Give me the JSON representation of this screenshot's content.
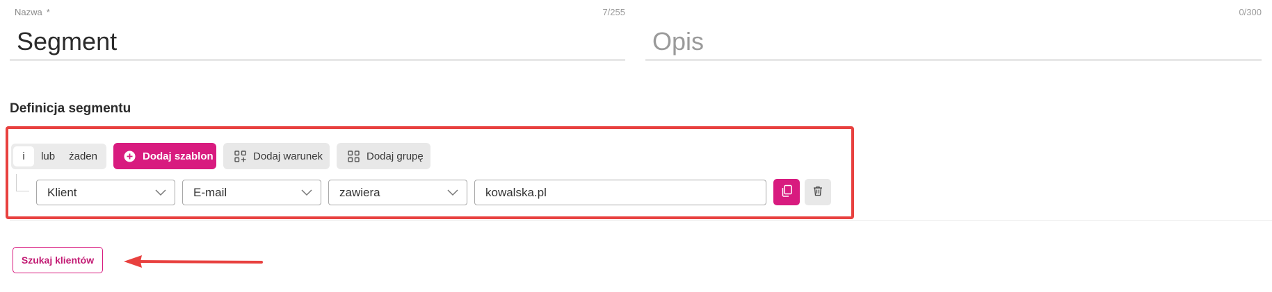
{
  "form": {
    "name": {
      "label": "Nazwa",
      "required_mark": "*",
      "counter": "7/255",
      "value": "Segment"
    },
    "description": {
      "counter": "0/300",
      "placeholder": "Opis"
    }
  },
  "definition": {
    "title": "Definicja segmentu",
    "logic_options": [
      "i",
      "lub",
      "żaden"
    ],
    "logic_selected": "i",
    "buttons": {
      "add_template": "Dodaj szablon",
      "add_condition": "Dodaj warunek",
      "add_group": "Dodaj grupę"
    },
    "condition": {
      "entity": "Klient",
      "field": "E-mail",
      "operator": "zawiera",
      "value": "kowalska.pl"
    }
  },
  "actions": {
    "search_clients": "Szukaj klientów"
  },
  "colors": {
    "accent": "#d81b7f",
    "annotation": "#e8413f"
  },
  "icons": [
    "plus-circle-icon",
    "add-condition-icon",
    "add-group-icon",
    "chevron-down-icon",
    "copy-icon",
    "trash-icon",
    "arrow-annotation"
  ]
}
